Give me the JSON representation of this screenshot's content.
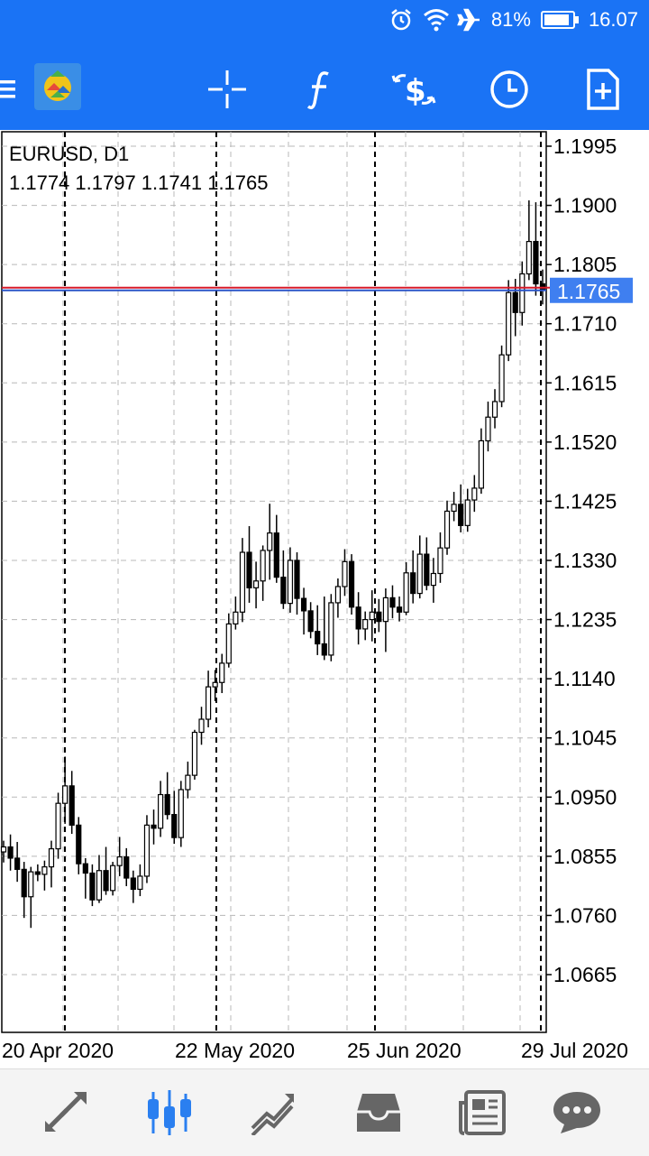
{
  "status_bar": {
    "battery": "81%",
    "time": "16.07",
    "icons": [
      "alarm-icon",
      "wifi-icon",
      "airplane-icon",
      "battery-icon"
    ]
  },
  "toolbar": {
    "icons": [
      "menu-icon",
      "app-logo-icon",
      "crosshair-icon",
      "indicators-icon",
      "symbol-change-icon",
      "timeframe-icon",
      "new-order-icon"
    ]
  },
  "chart_header": {
    "symbol": "EURUSD, D1",
    "ohlc": "1.1774 1.1797 1.1741 1.1765"
  },
  "bottom_nav": {
    "items": [
      "quotes-icon",
      "chart-icon",
      "trade-icon",
      "history-icon",
      "news-icon",
      "messages-icon"
    ],
    "active": "chart-icon"
  },
  "colors": {
    "accent": "#1a73f5",
    "price_line_bid": "#d81b2a",
    "price_line_ask": "#2a55c8",
    "price_label_bg": "#3f7ff0",
    "active_nav": "#2a7ff0",
    "inactive_nav": "#666666"
  },
  "chart_data": {
    "type": "candlestick",
    "symbol": "EURUSD",
    "timeframe": "D1",
    "y_ticks": [
      "1.1995",
      "1.1900",
      "1.1805",
      "1.1710",
      "1.1615",
      "1.1520",
      "1.1425",
      "1.1330",
      "1.1235",
      "1.1140",
      "1.1045",
      "1.0950",
      "1.0855",
      "1.0760",
      "1.0665"
    ],
    "ylim": [
      1.059,
      2.0
    ],
    "current_price": "1.1765",
    "x_labels": [
      "20 Apr 2020",
      "22 May 2020",
      "25 Jun 2020",
      "29 Jul 2020"
    ],
    "grid": true,
    "candles": [
      [
        1.0862,
        1.088,
        1.0845,
        1.087
      ],
      [
        1.087,
        1.089,
        1.0832,
        1.0852
      ],
      [
        1.0852,
        1.0878,
        1.0814,
        1.0834
      ],
      [
        1.0834,
        1.0846,
        1.0756,
        1.079
      ],
      [
        1.079,
        1.0838,
        1.074,
        1.083
      ],
      [
        1.083,
        1.0842,
        1.0815,
        1.0826
      ],
      [
        1.0826,
        1.0848,
        1.08,
        1.0838
      ],
      [
        1.0838,
        1.088,
        1.0805,
        1.0867
      ],
      [
        1.0867,
        1.0957,
        1.0851,
        1.094
      ],
      [
        1.094,
        1.1015,
        1.0907,
        1.0968
      ],
      [
        1.0968,
        1.0992,
        1.0891,
        1.0905
      ],
      [
        1.0905,
        1.0918,
        1.0826,
        1.0843
      ],
      [
        1.0843,
        1.0852,
        1.0787,
        1.0828
      ],
      [
        1.0828,
        1.0842,
        1.0775,
        1.0785
      ],
      [
        1.0785,
        1.0857,
        1.078,
        1.0832
      ],
      [
        1.0832,
        1.087,
        1.0793,
        1.08
      ],
      [
        1.08,
        1.0846,
        1.0792,
        1.084
      ],
      [
        1.084,
        1.0886,
        1.0823,
        1.0854
      ],
      [
        1.0854,
        1.0868,
        1.0807,
        1.082
      ],
      [
        1.082,
        1.0832,
        1.078,
        1.0802
      ],
      [
        1.0802,
        1.0842,
        1.0791,
        1.0823
      ],
      [
        1.0823,
        1.0921,
        1.0812,
        1.0905
      ],
      [
        1.0905,
        1.093,
        1.0874,
        1.09
      ],
      [
        1.09,
        1.0976,
        1.0886,
        1.0954
      ],
      [
        1.0954,
        1.099,
        1.0914,
        1.0922
      ],
      [
        1.0922,
        1.096,
        1.0875,
        1.0885
      ],
      [
        1.0885,
        1.0976,
        1.087,
        1.0962
      ],
      [
        1.0962,
        1.1007,
        1.0948,
        1.0985
      ],
      [
        1.0985,
        1.1058,
        1.0978,
        1.1054
      ],
      [
        1.1054,
        1.1095,
        1.1034,
        1.1075
      ],
      [
        1.1075,
        1.1153,
        1.1062,
        1.1127
      ],
      [
        1.1127,
        1.1154,
        1.1104,
        1.1134
      ],
      [
        1.1134,
        1.118,
        1.1117,
        1.1165
      ],
      [
        1.1165,
        1.1245,
        1.1158,
        1.1228
      ],
      [
        1.1228,
        1.1272,
        1.1219,
        1.1247
      ],
      [
        1.1247,
        1.1366,
        1.1231,
        1.1343
      ],
      [
        1.1343,
        1.1385,
        1.1262,
        1.1286
      ],
      [
        1.1286,
        1.1328,
        1.1253,
        1.1297
      ],
      [
        1.1297,
        1.1354,
        1.1265,
        1.1346
      ],
      [
        1.1346,
        1.1421,
        1.1299,
        1.1374
      ],
      [
        1.1374,
        1.1403,
        1.1294,
        1.1303
      ],
      [
        1.1303,
        1.1346,
        1.1252,
        1.1261
      ],
      [
        1.1261,
        1.1351,
        1.1246,
        1.133
      ],
      [
        1.133,
        1.1343,
        1.1243,
        1.1269
      ],
      [
        1.1269,
        1.1286,
        1.1211,
        1.1249
      ],
      [
        1.1249,
        1.1263,
        1.1205,
        1.1216
      ],
      [
        1.1216,
        1.1258,
        1.1178,
        1.1196
      ],
      [
        1.1196,
        1.1272,
        1.117,
        1.1178
      ],
      [
        1.1178,
        1.1276,
        1.1168,
        1.1262
      ],
      [
        1.1262,
        1.1301,
        1.1238,
        1.1288
      ],
      [
        1.1288,
        1.1348,
        1.1273,
        1.1328
      ],
      [
        1.1328,
        1.134,
        1.1243,
        1.1255
      ],
      [
        1.1255,
        1.1279,
        1.1195,
        1.122
      ],
      [
        1.122,
        1.1248,
        1.1202,
        1.1235
      ],
      [
        1.1235,
        1.1282,
        1.12,
        1.1247
      ],
      [
        1.1247,
        1.1268,
        1.1215,
        1.1232
      ],
      [
        1.1232,
        1.1285,
        1.1183,
        1.127
      ],
      [
        1.127,
        1.129,
        1.1237,
        1.1255
      ],
      [
        1.1255,
        1.1272,
        1.1232,
        1.1247
      ],
      [
        1.1247,
        1.1327,
        1.1242,
        1.131
      ],
      [
        1.131,
        1.1346,
        1.1261,
        1.1277
      ],
      [
        1.1277,
        1.137,
        1.1269,
        1.134
      ],
      [
        1.134,
        1.1367,
        1.1282,
        1.129
      ],
      [
        1.129,
        1.1334,
        1.1262,
        1.1309
      ],
      [
        1.1309,
        1.1375,
        1.1294,
        1.135
      ],
      [
        1.135,
        1.1426,
        1.1339,
        1.1409
      ],
      [
        1.1409,
        1.144,
        1.1393,
        1.142
      ],
      [
        1.142,
        1.1452,
        1.1375,
        1.1386
      ],
      [
        1.1386,
        1.1445,
        1.1376,
        1.1427
      ],
      [
        1.1427,
        1.1467,
        1.1408,
        1.1446
      ],
      [
        1.1446,
        1.1542,
        1.1437,
        1.1522
      ],
      [
        1.1522,
        1.1585,
        1.1505,
        1.156
      ],
      [
        1.156,
        1.1605,
        1.1542,
        1.1585
      ],
      [
        1.1585,
        1.1675,
        1.1576,
        1.166
      ],
      [
        1.166,
        1.178,
        1.165,
        1.176
      ],
      [
        1.176,
        1.1782,
        1.169,
        1.1728
      ],
      [
        1.1728,
        1.181,
        1.1707,
        1.179
      ],
      [
        1.179,
        1.1908,
        1.178,
        1.1842
      ],
      [
        1.1842,
        1.1905,
        1.1755,
        1.1774
      ],
      [
        1.1774,
        1.1797,
        1.1741,
        1.1765
      ]
    ]
  }
}
